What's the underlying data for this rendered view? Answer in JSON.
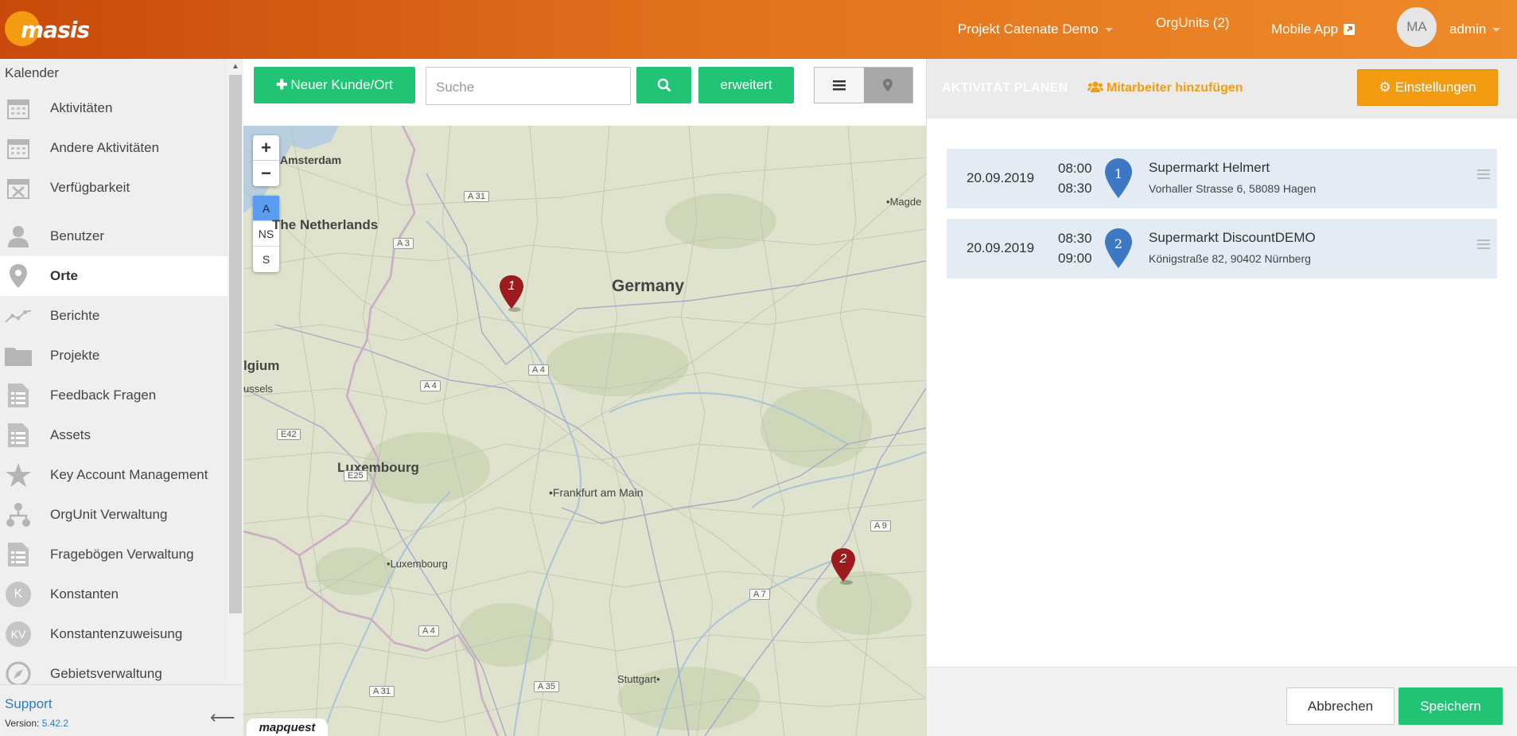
{
  "app": {
    "logo_text": "masis"
  },
  "header": {
    "project": "Projekt Catenate Demo",
    "orgunits": "OrgUnits (2)",
    "mobile_app": "Mobile App",
    "avatar_initials": "MA",
    "user": "admin"
  },
  "sidebar": {
    "heading": "Kalender",
    "items": [
      {
        "label": "Aktivitäten",
        "icon": "calendar-icon"
      },
      {
        "label": "Andere Aktivitäten",
        "icon": "calendar-icon"
      },
      {
        "label": "Verfügbarkeit",
        "icon": "calendar-x-icon"
      },
      {
        "label": "Benutzer",
        "icon": "user-icon"
      },
      {
        "label": "Orte",
        "icon": "map-marker-icon",
        "active": true
      },
      {
        "label": "Berichte",
        "icon": "line-chart-icon"
      },
      {
        "label": "Projekte",
        "icon": "folder-icon"
      },
      {
        "label": "Feedback Fragen",
        "icon": "document-list-icon"
      },
      {
        "label": "Assets",
        "icon": "document-list-icon"
      },
      {
        "label": "Key Account Management",
        "icon": "star-icon"
      },
      {
        "label": "OrgUnit Verwaltung",
        "icon": "org-tree-icon"
      },
      {
        "label": "Fragebögen Verwaltung",
        "icon": "document-list-icon"
      },
      {
        "label": "Konstanten",
        "icon": "k-circle-icon",
        "badge": "K"
      },
      {
        "label": "Konstantenzuweisung",
        "icon": "kv-circle-icon",
        "badge": "KV"
      },
      {
        "label": "Gebietsverwaltung",
        "icon": "compass-icon"
      }
    ],
    "support": "Support",
    "version_label": "Version:",
    "version": "5.42.2"
  },
  "toolbar": {
    "new_customer": "Neuer Kunde/Ort",
    "search_placeholder": "Suche",
    "advanced": "erweitert"
  },
  "map": {
    "zoom_in": "+",
    "zoom_out": "−",
    "layers": [
      "A",
      "NS",
      "S"
    ],
    "countries": [
      "The Netherlands",
      "Germany",
      "Luxembourg",
      "lgium"
    ],
    "cities": [
      "Amsterdam",
      "Frankfurt am Main",
      "Luxembourg",
      "Stuttgart",
      "Magde",
      "ussels"
    ],
    "roads": [
      "A 31",
      "A 3",
      "A 4",
      "A 4",
      "E42",
      "E25",
      "A 4",
      "A 31",
      "A 35",
      "A 7",
      "A 9"
    ],
    "markers": [
      "1",
      "2"
    ],
    "attribution": "mapquest"
  },
  "panel": {
    "title": "AKTIVITÄT PLANEN",
    "add_employee": "Mitarbeiter hinzufügen",
    "settings": "Einstellungen",
    "activities": [
      {
        "date": "20.09.2019",
        "start": "08:00",
        "end": "08:30",
        "num": "1",
        "name": "Supermarkt Helmert",
        "address": "Vorhaller Strasse 6, 58089 Hagen"
      },
      {
        "date": "20.09.2019",
        "start": "08:30",
        "end": "09:00",
        "num": "2",
        "name": "Supermarkt DiscountDEMO",
        "address": "Königstraße 82, 90402 Nürnberg"
      }
    ],
    "cancel": "Abbrechen",
    "save": "Speichern"
  },
  "colors": {
    "brand": "#e0711c",
    "accent_green": "#21c374",
    "accent_orange": "#f39c12",
    "marker_red": "#9b1b1f",
    "marker_blue": "#3f78c2"
  }
}
